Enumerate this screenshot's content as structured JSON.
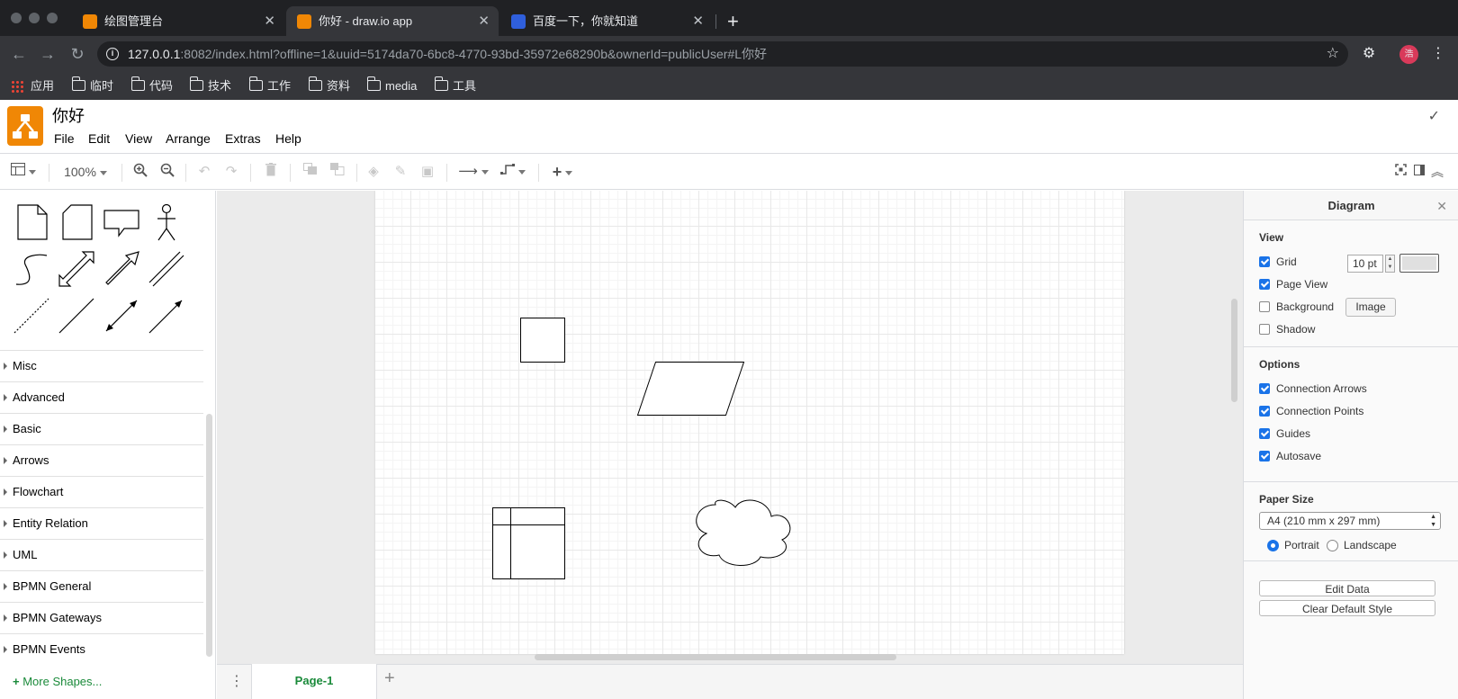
{
  "browser": {
    "tabs": [
      {
        "title": "绘图管理台",
        "active": false,
        "favicon": "drawio-icon"
      },
      {
        "title": "你好 - draw.io app",
        "active": true,
        "favicon": "drawio-icon"
      },
      {
        "title": "百度一下，你就知道",
        "active": false,
        "favicon": "baidu-icon"
      }
    ],
    "url_host": "127.0.0.1",
    "url_rest": ":8082/index.html?offline=1&uuid=5174da70-6bc8-4770-93bd-35972e68290b&ownerId=publicUser#L你好",
    "profile_initial": "浩",
    "bookmarks": [
      "应用",
      "临时",
      "代码",
      "技术",
      "工作",
      "资料",
      "media",
      "工具"
    ]
  },
  "app": {
    "title": "你好",
    "menus": [
      "File",
      "Edit",
      "View",
      "Arrange",
      "Extras",
      "Help"
    ],
    "accent": "#f08705"
  },
  "toolbar": {
    "zoom": "100%"
  },
  "sidebar": {
    "sections": [
      "Misc",
      "Advanced",
      "Basic",
      "Arrows",
      "Flowchart",
      "Entity Relation",
      "UML",
      "BPMN General",
      "BPMN Gateways",
      "BPMN Events"
    ],
    "more_shapes": "More Shapes..."
  },
  "pages": {
    "current": "Page-1"
  },
  "format_panel": {
    "title": "Diagram",
    "view_title": "View",
    "view_options": [
      {
        "label": "Grid",
        "checked": true
      },
      {
        "label": "Page View",
        "checked": true
      },
      {
        "label": "Background",
        "checked": false
      },
      {
        "label": "Shadow",
        "checked": false
      }
    ],
    "grid_size": "10 pt",
    "image_button": "Image",
    "options_title": "Options",
    "options": [
      {
        "label": "Connection Arrows",
        "checked": true
      },
      {
        "label": "Connection Points",
        "checked": true
      },
      {
        "label": "Guides",
        "checked": true
      },
      {
        "label": "Autosave",
        "checked": true
      }
    ],
    "paper_title": "Paper Size",
    "paper_size": "A4 (210 mm x 297 mm)",
    "orientation_portrait": "Portrait",
    "orientation_landscape": "Landscape",
    "orientation_selected": "Portrait",
    "edit_data": "Edit Data",
    "clear_style": "Clear Default Style"
  }
}
